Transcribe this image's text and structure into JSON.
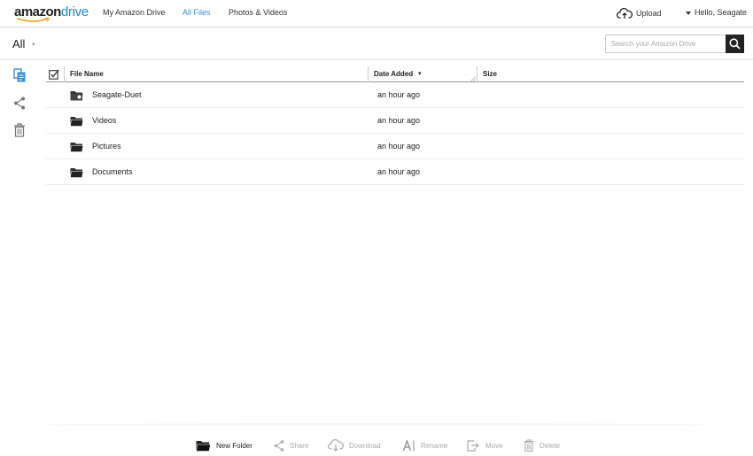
{
  "brand": {
    "amazon": "amazon",
    "drive": "drive",
    "accent_color": "#1e88c9"
  },
  "nav": {
    "my_drive": "My Amazon Drive",
    "all_files": "All Files",
    "photos_videos": "Photos & Videos",
    "upload": "Upload",
    "greeting": "Hello, Seagate"
  },
  "breadcrumb": {
    "current": "All"
  },
  "search": {
    "placeholder": "Search your Amazon Drive",
    "icon": "magnifier-icon"
  },
  "sidebar": {
    "items": [
      {
        "name": "files-icon",
        "color": "#3d8fd1"
      },
      {
        "name": "share-icon"
      },
      {
        "name": "trash-icon"
      }
    ]
  },
  "table": {
    "columns": {
      "name": "File Name",
      "date": "Date Added",
      "size": "Size"
    },
    "rows": [
      {
        "name": "Seagate-Duet",
        "date": "an hour ago",
        "size": ""
      },
      {
        "name": "Videos",
        "date": "an hour ago",
        "size": ""
      },
      {
        "name": "Pictures",
        "date": "an hour ago",
        "size": ""
      },
      {
        "name": "Documents",
        "date": "an hour ago",
        "size": ""
      }
    ]
  },
  "toolbar": {
    "new_folder": "New Folder",
    "share": "Share",
    "download": "Download",
    "rename": "Rename",
    "move": "Move",
    "delete": "Delete"
  }
}
